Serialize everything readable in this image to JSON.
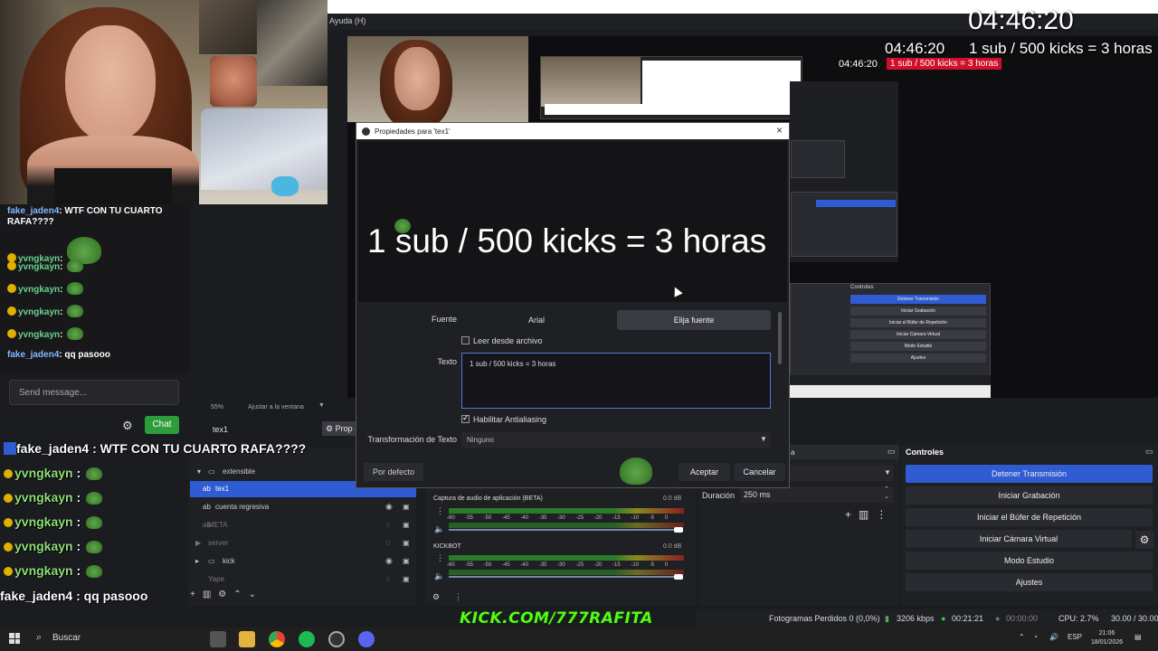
{
  "obs": {
    "menu_item": "Ayuda (H)",
    "zoom": "55%",
    "fit_label": "Ajustar a la ventana",
    "selected_source_tab": "tex1",
    "properties_button": "Prop",
    "sources": [
      {
        "label": "extensible",
        "type": "group"
      },
      {
        "label": "tex1",
        "type": "text",
        "selected": true
      },
      {
        "label": "cuenta regresiva",
        "type": "text"
      },
      {
        "label": "META",
        "type": "text"
      },
      {
        "label": "server",
        "type": "media"
      },
      {
        "label": "kick",
        "type": "group"
      },
      {
        "label": "Yape",
        "type": "text"
      }
    ],
    "preview_timer": "04:46:20",
    "preview_sub_goal": "1 sub / 500 kicks = 3 horas"
  },
  "dialog": {
    "title": "Propiedades para 'tex1'",
    "preview_text": "1 sub / 500 kicks = 3 horas",
    "font_label": "Fuente",
    "font_value": "Arial",
    "choose_font": "Elija fuente",
    "read_file_label": "Leer desde archivo",
    "text_label": "Texto",
    "text_value": "1 sub / 500 kicks = 3 horas",
    "antialias_label": "Habilitar Antialiasing",
    "transform_label": "Transformación de Texto",
    "transform_value": "Ninguno",
    "default_button": "Por defecto",
    "accept_button": "Aceptar",
    "cancel_button": "Cancelar"
  },
  "mixer": {
    "track1_label": "Captura de audio de aplicación (BETA)",
    "track1_db": "0.0 dB",
    "track2_label": "KICKBOT",
    "track2_db": "0.0 dB",
    "ticks": "-60 -55 -50 -45 -40 -35 -30 -25 -20 -15 -10 -5 0"
  },
  "transitions": {
    "header_fragment": "a",
    "duration_label": "Duración",
    "duration_value": "250 ms"
  },
  "controls": {
    "title": "Controles",
    "buttons": [
      "Detener Transmisión",
      "Iniciar Grabación",
      "Iniciar el Búfer de Repetición",
      "Iniciar Cámara Virtual",
      "Modo Estudio",
      "Ajustes"
    ]
  },
  "status": {
    "dropped_frames": "Fotogramas Perdidos 0 (0,0%)",
    "bitrate": "3206 kbps",
    "stream_time": "00:21:21",
    "rec_time": "00:00:00",
    "cpu": "CPU: 2.7%",
    "fps": "30.00 / 30.00 FPS"
  },
  "overlay": {
    "timer_big": "04:46:20",
    "timer_mid": "04:46:20",
    "sub_goal": "1 sub / 500 kicks = 3 horas",
    "kick_banner": "KICK.COM/777RAFITA"
  },
  "chat": {
    "messages": [
      {
        "user": "fake_jaden4",
        "text": "WTF CON TU CUARTO RAFA????"
      },
      {
        "user": "yvngkayn",
        "text": ""
      },
      {
        "user": "yvngkayn",
        "text": ""
      },
      {
        "user": "yvngkayn",
        "text": ""
      },
      {
        "user": "yvngkayn",
        "text": ""
      },
      {
        "user": "yvngkayn",
        "text": ""
      },
      {
        "user": "fake_jaden4",
        "text": "qq pasooo"
      }
    ],
    "input_placeholder": "Send message...",
    "send_button": "Chat"
  },
  "overlay_chat": {
    "messages": [
      {
        "user": "fake_jaden4",
        "text": "WTF CON TU CUARTO RAFA????"
      },
      {
        "user": "yvngkayn",
        "text": ""
      },
      {
        "user": "yvngkayn",
        "text": ""
      },
      {
        "user": "yvngkayn",
        "text": ""
      },
      {
        "user": "yvngkayn",
        "text": ""
      },
      {
        "user": "yvngkayn",
        "text": ""
      },
      {
        "user": "fake_jaden4",
        "text": "qq pasooo"
      }
    ],
    "colon": ":"
  },
  "taskbar": {
    "search": "Buscar",
    "lang": "ESP",
    "time": "21:06",
    "date": "18/01/2026"
  },
  "colors": {
    "accent": "#2f5bd3",
    "kick_green": "#53fc18",
    "chat_button": "#2d9c3a"
  }
}
